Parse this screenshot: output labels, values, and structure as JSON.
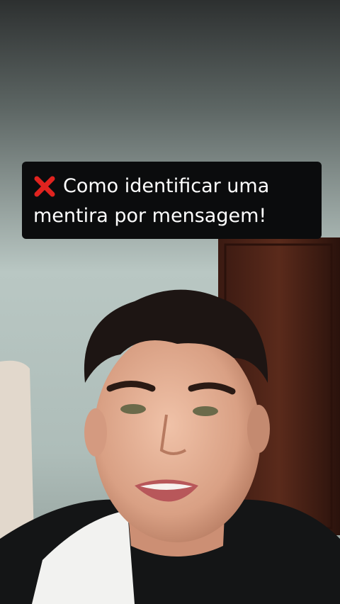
{
  "caption": {
    "icon": "red-cross-mark-icon",
    "line1": "Como identificar uma",
    "line2": "mentira por mensagem!"
  },
  "colors": {
    "caption_bg": "#0b0c0d",
    "caption_text": "#ffffff",
    "icon": "#e0231f"
  }
}
